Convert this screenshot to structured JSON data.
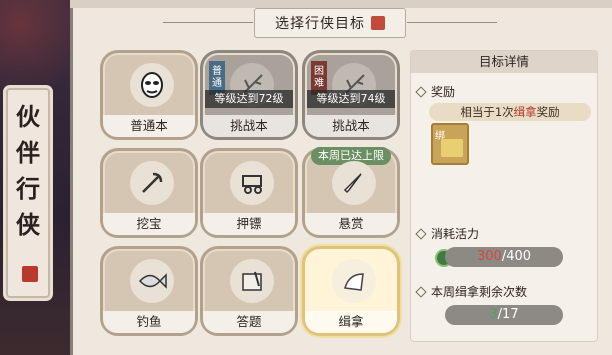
{
  "header": {
    "title": "选择行侠目标"
  },
  "side_banner": {
    "chars": [
      "伙",
      "伴",
      "行",
      "侠"
    ]
  },
  "activities": [
    {
      "label": "普通本",
      "icon": "mask-icon",
      "state": "normal"
    },
    {
      "label": "挑战本",
      "icon": "branch-icon",
      "state": "locked",
      "tag": [
        "普",
        "通"
      ],
      "lock_text": "等级达到72级"
    },
    {
      "label": "挑战本",
      "icon": "branch-icon",
      "state": "locked",
      "tag": [
        "困",
        "难"
      ],
      "lock_text": "等级达到74级"
    },
    {
      "label": "挖宝",
      "icon": "pickaxe-icon",
      "state": "normal"
    },
    {
      "label": "押镖",
      "icon": "cart-icon",
      "state": "normal"
    },
    {
      "label": "悬赏",
      "icon": "dagger-icon",
      "state": "normal",
      "limit_text": "本周已达上限"
    },
    {
      "label": "钓鱼",
      "icon": "fish-icon",
      "state": "normal"
    },
    {
      "label": "答题",
      "icon": "scroll-icon",
      "state": "normal"
    },
    {
      "label": "缉拿",
      "icon": "paper-icon",
      "state": "selected"
    }
  ],
  "detail": {
    "title": "目标详情",
    "reward_label": "奖励",
    "reward_text_prefix": "相当于1次",
    "reward_text_highlight": "缉拿",
    "reward_text_suffix": "奖励",
    "item_bind_label": "绑",
    "energy_label": "消耗活力",
    "energy_current": "300",
    "energy_total": "/400",
    "remain_label": "本周缉拿剩余次数",
    "remain_current": "3",
    "remain_total": "/17"
  }
}
